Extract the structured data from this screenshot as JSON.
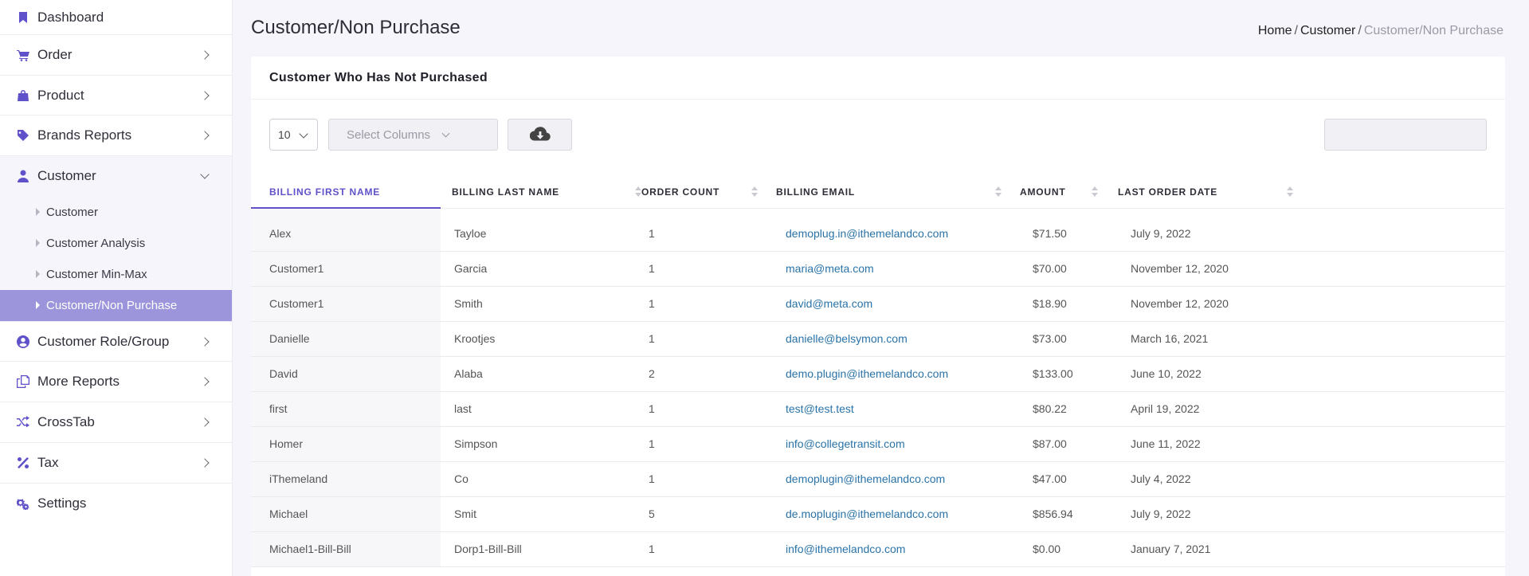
{
  "sidebar": {
    "items": [
      {
        "label": "Dashboard",
        "icon": "bookmark-icon"
      },
      {
        "label": "Order",
        "icon": "cart-icon"
      },
      {
        "label": "Product",
        "icon": "shopping-bag-icon"
      },
      {
        "label": "Brands Reports",
        "icon": "tag-icon"
      },
      {
        "label": "Customer",
        "icon": "user-icon"
      },
      {
        "label": "Customer Role/Group",
        "icon": "user-circle-icon"
      },
      {
        "label": "More Reports",
        "icon": "copy-icon"
      },
      {
        "label": "CrossTab",
        "icon": "shuffle-icon"
      },
      {
        "label": "Tax",
        "icon": "percent-icon"
      },
      {
        "label": "Settings",
        "icon": "cogs-icon"
      }
    ],
    "customer_sub": [
      "Customer",
      "Customer Analysis",
      "Customer Min-Max",
      "Customer/Non Purchase"
    ]
  },
  "page": {
    "title": "Customer/Non Purchase",
    "breadcrumb": {
      "home": "Home",
      "sep": "/",
      "section": "Customer",
      "current": "Customer/Non Purchase"
    }
  },
  "card": {
    "title": "Customer Who Has Not Purchased",
    "page_size": "10",
    "select_columns": "Select Columns"
  },
  "table": {
    "headers": [
      "BILLING FIRST NAME",
      "BILLING LAST NAME",
      "ORDER COUNT",
      "BILLING EMAIL",
      "AMOUNT",
      "LAST ORDER DATE"
    ],
    "rows": [
      [
        "Alex",
        "Tayloe",
        "1",
        "demoplug.in@ithemelandco.com",
        "$71.50",
        "July 9, 2022"
      ],
      [
        "Customer1",
        "Garcia",
        "1",
        "maria@meta.com",
        "$70.00",
        "November 12, 2020"
      ],
      [
        "Customer1",
        "Smith",
        "1",
        "david@meta.com",
        "$18.90",
        "November 12, 2020"
      ],
      [
        "Danielle",
        "Krootjes",
        "1",
        "danielle@belsymon.com",
        "$73.00",
        "March 16, 2021"
      ],
      [
        "David",
        "Alaba",
        "2",
        "demo.plugin@ithemelandco.com",
        "$133.00",
        "June 10, 2022"
      ],
      [
        "first",
        "last",
        "1",
        "test@test.test",
        "$80.22",
        "April 19, 2022"
      ],
      [
        "Homer",
        "Simpson",
        "1",
        "info@collegetransit.com",
        "$87.00",
        "June 11, 2022"
      ],
      [
        "iThemeland",
        "Co",
        "1",
        "demoplugin@ithemelandco.com",
        "$47.00",
        "July 4, 2022"
      ],
      [
        "Michael",
        "Smit",
        "5",
        "de.moplugin@ithemelandco.com",
        "$856.94",
        "July 9, 2022"
      ],
      [
        "Michael1-Bill-Bill",
        "Dorp1-Bill-Bill",
        "1",
        "info@ithemelandco.com",
        "$0.00",
        "January 7, 2021"
      ]
    ]
  },
  "colors": {
    "accent": "#5f51c9",
    "active_bg": "#9d95db",
    "link": "#2a73a8"
  }
}
